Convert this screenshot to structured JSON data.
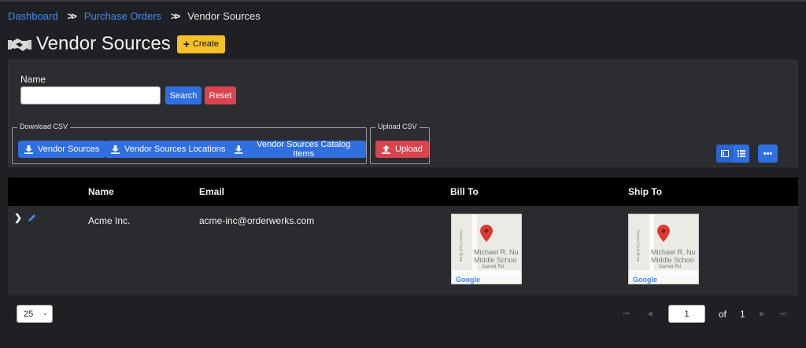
{
  "breadcrumb": {
    "items": [
      "Dashboard",
      "Purchase Orders"
    ],
    "current": "Vendor Sources"
  },
  "header": {
    "title": "Vendor Sources",
    "create_label": "Create"
  },
  "filter": {
    "name_label": "Name",
    "name_value": "",
    "search_label": "Search",
    "reset_label": "Reset"
  },
  "download_csv": {
    "legend": "Download CSV",
    "buttons": [
      "Vendor Sources",
      "Vendor Sources Locations",
      "Vendor Sources Catalog Items"
    ]
  },
  "upload_csv": {
    "legend": "Upload CSV",
    "button": "Upload"
  },
  "more_button": "•••",
  "table": {
    "columns": [
      "Name",
      "Email",
      "Bill To",
      "Ship To"
    ],
    "rows": [
      {
        "name": "Acme Inc.",
        "email": "acme-inc@orderwerks.com",
        "bill_to_map": {
          "poi_line1": "Michael R. Nu",
          "poi_line2": "Middle Schoo",
          "road_h": "Garrett Rd",
          "road_v": "Green Coral Drive",
          "logo": "Google"
        },
        "ship_to_map": {
          "poi_line1": "Michael R. Nu",
          "poi_line2": "Middle Schoo",
          "road_h": "Garrett Rd",
          "road_v": "Green Coral Drive",
          "logo": "Google"
        }
      }
    ]
  },
  "pagination": {
    "page_size": "25",
    "current_page": "1",
    "of_label": "of",
    "total_pages": "1"
  },
  "icons": {
    "title_icon": "handshake-icon",
    "create_icon": "plus-icon",
    "download_icon": "download-icon",
    "upload_icon": "upload-icon",
    "expand_icon": "chevron-right-icon",
    "edit_icon": "pencil-icon",
    "map_pin": "map-pin-icon"
  },
  "colors": {
    "primary": "#2f6fe0",
    "danger": "#d9444f",
    "warning": "#f5c027",
    "link": "#3d8bfd",
    "background": "#1f2023"
  }
}
